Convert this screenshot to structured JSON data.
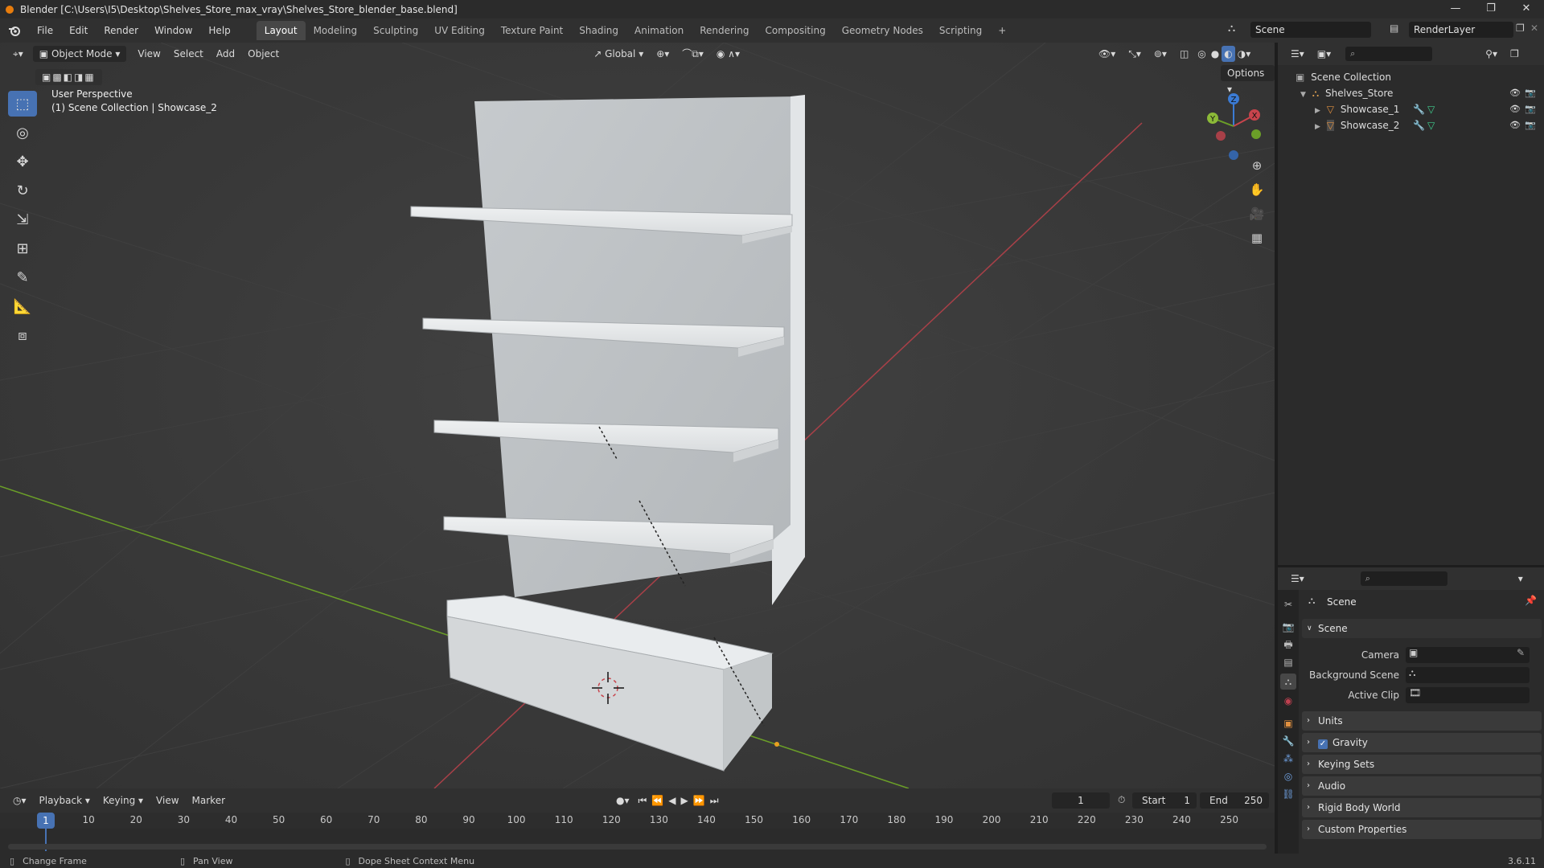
{
  "window": {
    "title": "Blender [C:\\Users\\I5\\Desktop\\Shelves_Store_max_vray\\Shelves_Store_blender_base.blend]",
    "controls": [
      "—",
      "❐",
      "✕"
    ]
  },
  "menu": [
    "File",
    "Edit",
    "Render",
    "Window",
    "Help"
  ],
  "workspaces": [
    "Layout",
    "Modeling",
    "Sculpting",
    "UV Editing",
    "Texture Paint",
    "Shading",
    "Animation",
    "Rendering",
    "Compositing",
    "Geometry Nodes",
    "Scripting",
    "+"
  ],
  "active_workspace": "Layout",
  "scene_name": "Scene",
  "view_layer": "RenderLayer",
  "viewport": {
    "mode": "Object Mode",
    "menus": [
      "View",
      "Select",
      "Add",
      "Object"
    ],
    "orientation": "Global",
    "options_label": "Options",
    "perspective_label": "User Perspective",
    "collection_label": "(1) Scene Collection | Showcase_2",
    "gizmo_axes": [
      "X",
      "Y",
      "Z"
    ]
  },
  "outliner": {
    "root": "Scene Collection",
    "collection": "Shelves_Store",
    "objects": [
      "Showcase_1",
      "Showcase_2"
    ]
  },
  "properties": {
    "context": "Scene",
    "panel": "Scene",
    "fields": [
      "Camera",
      "Background Scene",
      "Active Clip"
    ],
    "sections": [
      "Units",
      "Gravity",
      "Keying Sets",
      "Audio",
      "Rigid Body World",
      "Custom Properties"
    ],
    "gravity_checked": true
  },
  "timeline": {
    "menus": [
      "Playback",
      "Keying",
      "View",
      "Marker"
    ],
    "current_frame": "1",
    "start_label": "Start",
    "start": "1",
    "end_label": "End",
    "end": "250",
    "ticks": [
      "1",
      "10",
      "20",
      "30",
      "40",
      "50",
      "60",
      "70",
      "80",
      "90",
      "100",
      "110",
      "120",
      "130",
      "140",
      "150",
      "160",
      "170",
      "180",
      "190",
      "200",
      "210",
      "220",
      "230",
      "240",
      "250"
    ]
  },
  "statusbar": {
    "hints": [
      "Change Frame",
      "Pan View",
      "Dope Sheet Context Menu"
    ],
    "version": "3.6.11"
  },
  "colors": {
    "accent": "#4772b3",
    "x_axis": "#c8444c",
    "y_axis": "#6b9f28",
    "z_axis": "#3b7bd4",
    "brand": "#e87d0d"
  }
}
